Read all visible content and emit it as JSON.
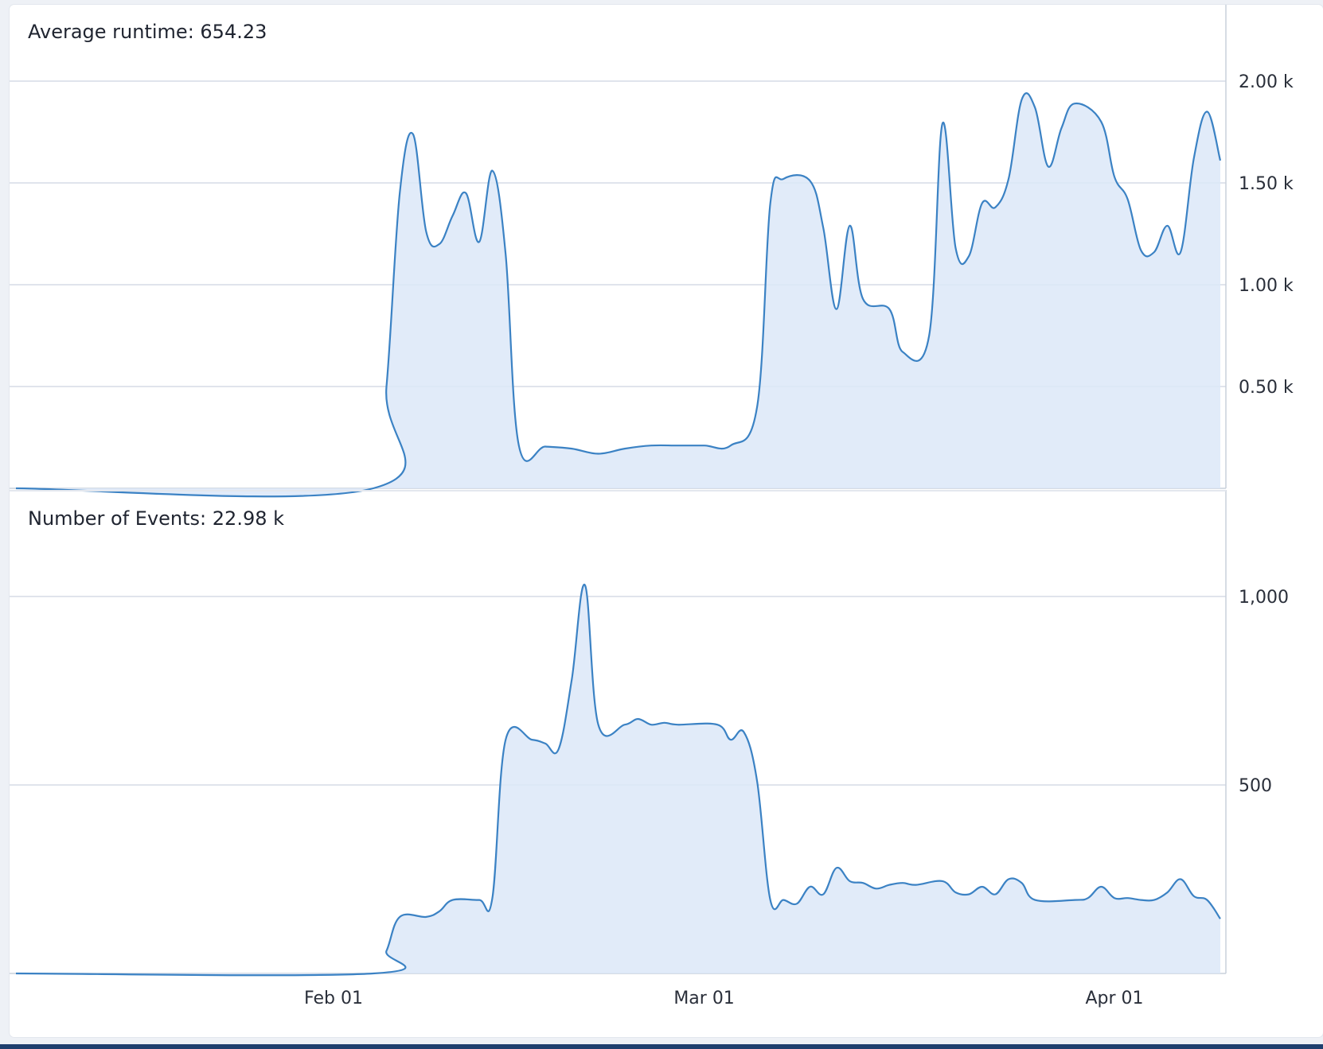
{
  "colors": {
    "line": "#3b82c4",
    "fill": "#dce8f8",
    "grid": "#d5dbe5"
  },
  "chart_data": [
    {
      "type": "area",
      "title": "Average runtime: 654.23",
      "y_ticks": [
        {
          "value": 500,
          "label": "0.50 k"
        },
        {
          "value": 1000,
          "label": "1.00 k"
        },
        {
          "value": 1500,
          "label": "1.50 k"
        },
        {
          "value": 2000,
          "label": "2.00 k"
        }
      ],
      "ylim": [
        0,
        2000
      ],
      "grid": true,
      "points": [
        [
          "2025-01-08",
          0
        ],
        [
          "2025-02-04",
          0
        ],
        [
          "2025-02-05",
          500
        ],
        [
          "2025-02-06",
          1450
        ],
        [
          "2025-02-07",
          1740
        ],
        [
          "2025-02-08",
          1260
        ],
        [
          "2025-02-09",
          1200
        ],
        [
          "2025-02-10",
          1340
        ],
        [
          "2025-02-11",
          1450
        ],
        [
          "2025-02-12",
          1210
        ],
        [
          "2025-02-13",
          1560
        ],
        [
          "2025-02-14",
          1150
        ],
        [
          "2025-02-15",
          210
        ],
        [
          "2025-02-17",
          205
        ],
        [
          "2025-02-19",
          195
        ],
        [
          "2025-02-21",
          170
        ],
        [
          "2025-02-23",
          195
        ],
        [
          "2025-02-25",
          210
        ],
        [
          "2025-02-27",
          210
        ],
        [
          "2025-03-01",
          210
        ],
        [
          "2025-03-03",
          210
        ],
        [
          "2025-03-05",
          400
        ],
        [
          "2025-03-06",
          1400
        ],
        [
          "2025-03-07",
          1520
        ],
        [
          "2025-03-09",
          1510
        ],
        [
          "2025-03-10",
          1280
        ],
        [
          "2025-03-11",
          880
        ],
        [
          "2025-03-12",
          1290
        ],
        [
          "2025-03-13",
          930
        ],
        [
          "2025-03-15",
          880
        ],
        [
          "2025-03-16",
          670
        ],
        [
          "2025-03-18",
          750
        ],
        [
          "2025-03-19",
          1790
        ],
        [
          "2025-03-20",
          1180
        ],
        [
          "2025-03-21",
          1140
        ],
        [
          "2025-03-22",
          1400
        ],
        [
          "2025-03-23",
          1380
        ],
        [
          "2025-03-24",
          1520
        ],
        [
          "2025-03-25",
          1910
        ],
        [
          "2025-03-26",
          1870
        ],
        [
          "2025-03-27",
          1580
        ],
        [
          "2025-03-28",
          1770
        ],
        [
          "2025-03-29",
          1890
        ],
        [
          "2025-03-31",
          1800
        ],
        [
          "2025-04-01",
          1530
        ],
        [
          "2025-04-02",
          1420
        ],
        [
          "2025-04-03",
          1170
        ],
        [
          "2025-04-04",
          1160
        ],
        [
          "2025-04-05",
          1290
        ],
        [
          "2025-04-06",
          1160
        ],
        [
          "2025-04-07",
          1620
        ],
        [
          "2025-04-08",
          1850
        ],
        [
          "2025-04-09",
          1610
        ]
      ]
    },
    {
      "type": "area",
      "title": "Number of Events: 22.98 k",
      "y_ticks": [
        {
          "value": 500,
          "label": "500"
        },
        {
          "value": 1000,
          "label": "1,000"
        }
      ],
      "ylim": [
        0,
        1000
      ],
      "grid": true,
      "x_ticks": [
        {
          "value": "2025-02-01",
          "label": "Feb 01"
        },
        {
          "value": "2025-03-01",
          "label": "Mar 01"
        },
        {
          "value": "2025-04-01",
          "label": "Apr 01"
        }
      ],
      "points": [
        [
          "2025-01-08",
          0
        ],
        [
          "2025-02-04",
          0
        ],
        [
          "2025-02-05",
          60
        ],
        [
          "2025-02-06",
          150
        ],
        [
          "2025-02-08",
          150
        ],
        [
          "2025-02-09",
          165
        ],
        [
          "2025-02-10",
          195
        ],
        [
          "2025-02-12",
          195
        ],
        [
          "2025-02-13",
          200
        ],
        [
          "2025-02-14",
          620
        ],
        [
          "2025-02-16",
          620
        ],
        [
          "2025-02-17",
          610
        ],
        [
          "2025-02-18",
          595
        ],
        [
          "2025-02-19",
          780
        ],
        [
          "2025-02-20",
          1030
        ],
        [
          "2025-02-21",
          660
        ],
        [
          "2025-02-23",
          660
        ],
        [
          "2025-02-24",
          675
        ],
        [
          "2025-02-25",
          660
        ],
        [
          "2025-02-26",
          665
        ],
        [
          "2025-02-27",
          660
        ],
        [
          "2025-03-02",
          660
        ],
        [
          "2025-03-03",
          620
        ],
        [
          "2025-03-04",
          640
        ],
        [
          "2025-03-05",
          510
        ],
        [
          "2025-03-06",
          195
        ],
        [
          "2025-03-07",
          195
        ],
        [
          "2025-03-08",
          185
        ],
        [
          "2025-03-09",
          230
        ],
        [
          "2025-03-10",
          210
        ],
        [
          "2025-03-11",
          280
        ],
        [
          "2025-03-12",
          245
        ],
        [
          "2025-03-13",
          240
        ],
        [
          "2025-03-14",
          225
        ],
        [
          "2025-03-15",
          235
        ],
        [
          "2025-03-16",
          240
        ],
        [
          "2025-03-17",
          235
        ],
        [
          "2025-03-19",
          245
        ],
        [
          "2025-03-20",
          215
        ],
        [
          "2025-03-21",
          210
        ],
        [
          "2025-03-22",
          230
        ],
        [
          "2025-03-23",
          210
        ],
        [
          "2025-03-24",
          250
        ],
        [
          "2025-03-25",
          240
        ],
        [
          "2025-03-26",
          195
        ],
        [
          "2025-03-29",
          195
        ],
        [
          "2025-03-30",
          200
        ],
        [
          "2025-03-31",
          230
        ],
        [
          "2025-04-01",
          200
        ],
        [
          "2025-04-02",
          200
        ],
        [
          "2025-04-03",
          195
        ],
        [
          "2025-04-04",
          195
        ],
        [
          "2025-04-05",
          215
        ],
        [
          "2025-04-06",
          250
        ],
        [
          "2025-04-07",
          205
        ],
        [
          "2025-04-08",
          195
        ],
        [
          "2025-04-09",
          145
        ]
      ]
    }
  ]
}
